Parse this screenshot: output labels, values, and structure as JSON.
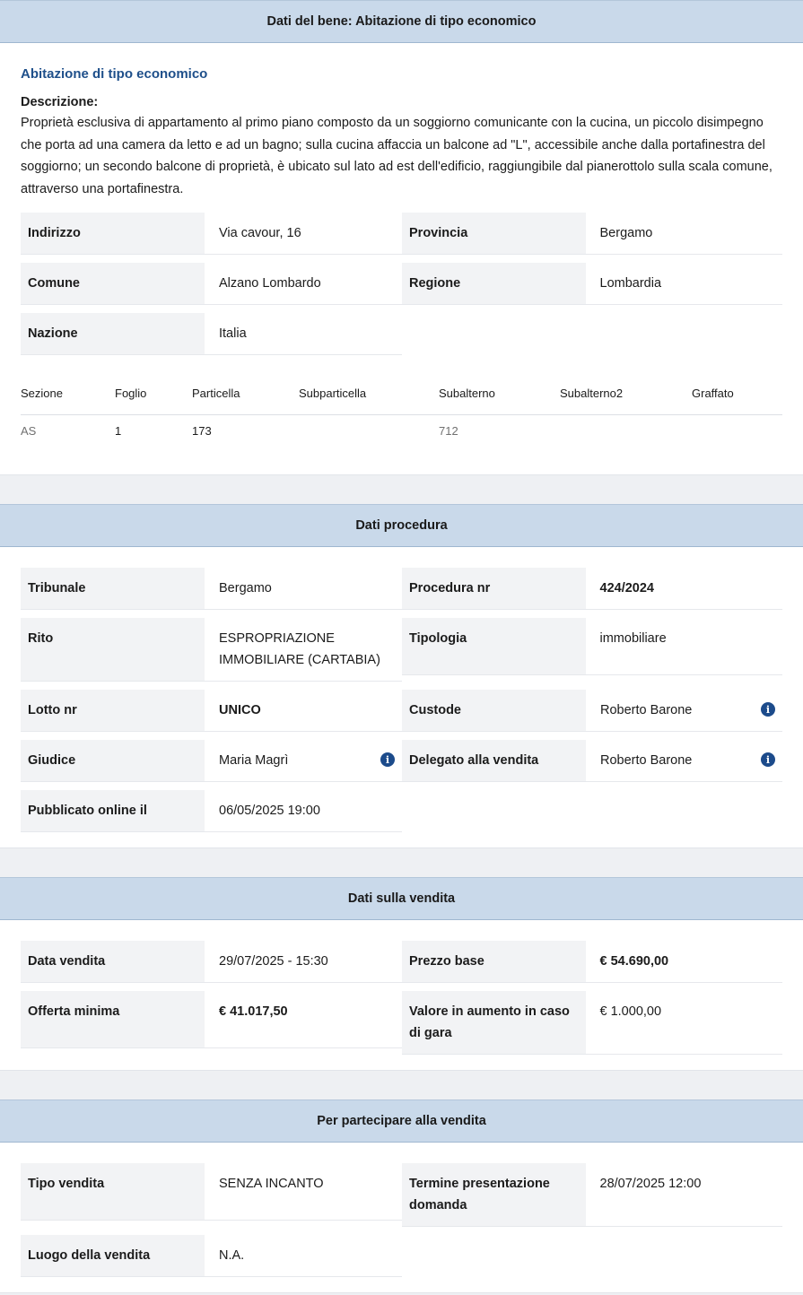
{
  "bene": {
    "header": "Dati del bene: Abitazione di tipo economico",
    "title": "Abitazione di tipo economico",
    "description_label": "Descrizione:",
    "description": "Proprietà esclusiva di appartamento al primo piano composto da un soggiorno comunicante con la cucina, un piccolo disimpegno che porta ad una camera da letto e ad un bagno; sulla cucina affaccia un balcone ad \"L\", accessibile anche dalla portafinestra del soggiorno; un secondo balcone di proprietà, è ubicato sul lato ad est dell'edificio, raggiungibile dal pianerottolo sulla scala comune, attraverso una portafinestra.",
    "fields": {
      "indirizzo_label": "Indirizzo",
      "indirizzo": "Via cavour, 16",
      "provincia_label": "Provincia",
      "provincia": "Bergamo",
      "comune_label": "Comune",
      "comune": "Alzano Lombardo",
      "regione_label": "Regione",
      "regione": "Lombardia",
      "nazione_label": "Nazione",
      "nazione": "Italia"
    },
    "catasto": {
      "headers": [
        "Sezione",
        "Foglio",
        "Particella",
        "Subparticella",
        "Subalterno",
        "Subalterno2",
        "Graffato"
      ],
      "values": [
        "AS",
        "1",
        "173",
        "",
        "712",
        "",
        ""
      ]
    }
  },
  "procedura": {
    "header": "Dati procedura",
    "tribunale_label": "Tribunale",
    "tribunale": "Bergamo",
    "procedura_label": "Procedura nr",
    "procedura": "424/2024",
    "rito_label": "Rito",
    "rito": "ESPROPRIAZIONE IMMOBILIARE (CARTABIA)",
    "tipologia_label": "Tipologia",
    "tipologia": "immobiliare",
    "lotto_label": "Lotto nr",
    "lotto": "UNICO",
    "custode_label": "Custode",
    "custode": "Roberto Barone",
    "giudice_label": "Giudice",
    "giudice": "Maria Magrì",
    "delegato_label": "Delegato alla vendita",
    "delegato": "Roberto Barone",
    "pubblicato_label": "Pubblicato online il",
    "pubblicato": "06/05/2025 19:00",
    "info_icon_glyph": "i"
  },
  "vendita": {
    "header": "Dati sulla vendita",
    "data_label": "Data vendita",
    "data": "29/07/2025 - 15:30",
    "prezzo_label": "Prezzo base",
    "prezzo": "€ 54.690,00",
    "offerta_label": "Offerta minima",
    "offerta": "€ 41.017,50",
    "aumento_label": "Valore in aumento in caso di gara",
    "aumento": "€ 1.000,00"
  },
  "partecipare": {
    "header": "Per partecipare alla vendita",
    "tipo_label": "Tipo vendita",
    "tipo": "SENZA INCANTO",
    "termine_label": "Termine presentazione domanda",
    "termine": "28/07/2025 12:00",
    "luogo_label": "Luogo della vendita",
    "luogo": "N.A."
  },
  "colors": {
    "header_bg": "#c9d9ea",
    "title_blue": "#1e4f8a",
    "label_bg": "#f2f3f5",
    "info_icon": "#1c4b8b"
  }
}
